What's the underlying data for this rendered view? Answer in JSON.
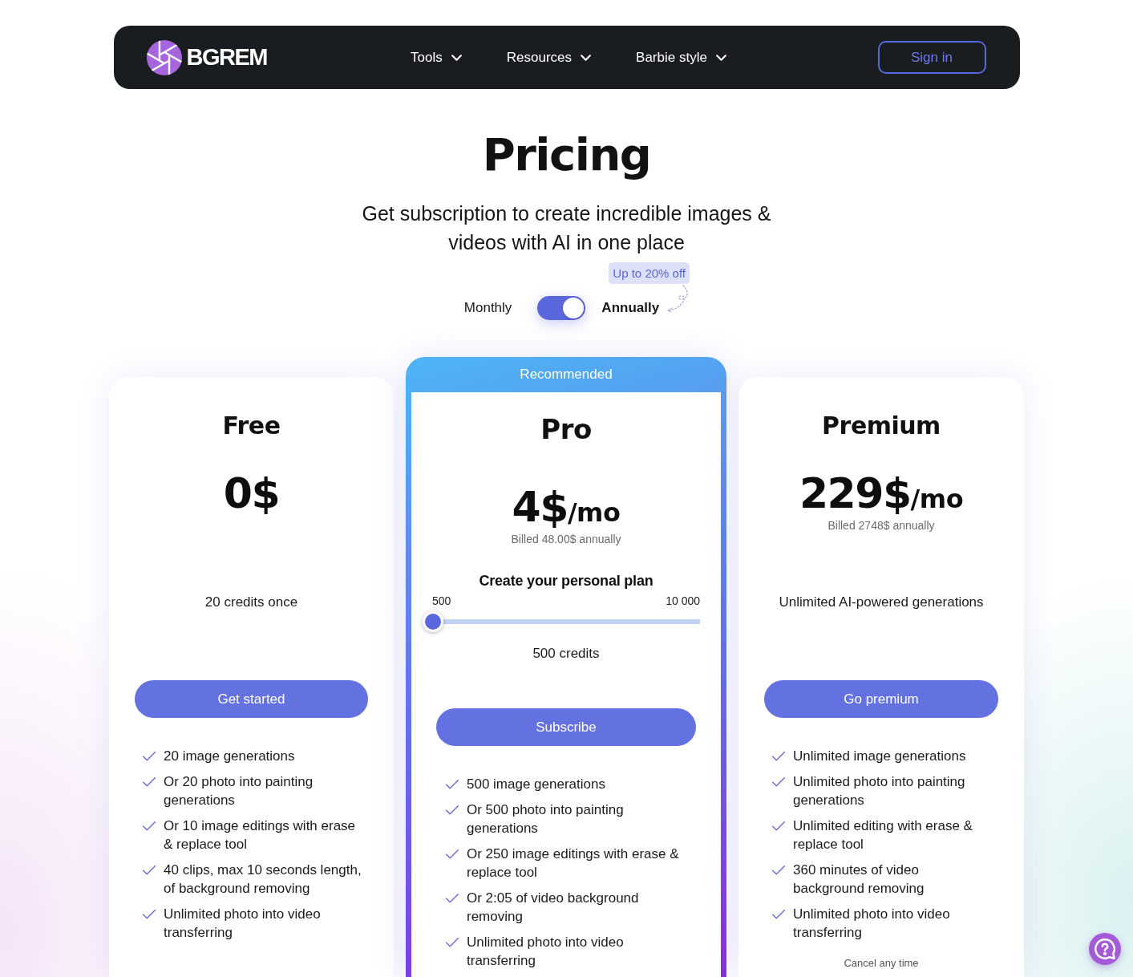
{
  "nav": {
    "logo": "BGREM",
    "items": [
      {
        "label": "Tools"
      },
      {
        "label": "Resources"
      },
      {
        "label": "Barbie style"
      }
    ],
    "sign_in": "Sign in"
  },
  "hero": {
    "title": "Pricing",
    "subtitle": "Get subscription to create incredible images & videos with AI in one place"
  },
  "billing": {
    "monthly_label": "Monthly",
    "annual_label": "Annually",
    "on": true,
    "badge": "Up to 20% off"
  },
  "plans": [
    {
      "name": "Free",
      "recommended": false,
      "price": "0$",
      "credits": "20 credits once",
      "button": "Get started",
      "features": [
        "20 image generations",
        "Or 20 photo into painting generations",
        "Or 10 image editings with erase & replace tool",
        "40 clips, max 10 seconds length, of background removing",
        "Unlimited photo into video transferring"
      ]
    },
    {
      "name": "Pro",
      "recommended": true,
      "ribbon": "Recommended",
      "price": "4$",
      "period": "/mo",
      "billing_note": "Billed 48.00$ annually",
      "custom_plan": {
        "title": "Create your personal plan",
        "min_label": "500",
        "max_label": "10 000",
        "level": 0
      },
      "credits": "500 credits",
      "button": "Subscribe",
      "features": [
        "500 image generations",
        "Or 500 photo into painting generations",
        "Or 250 image editings with erase & replace tool",
        "Or 2:05 of video background removing",
        "Unlimited photo into video transferring"
      ]
    },
    {
      "name": "Premium",
      "recommended": false,
      "price": "229$",
      "period": "/mo",
      "billing_note": "Billed 2748$ annually",
      "credits": "Unlimited AI-powered generations",
      "button": "Go premium",
      "features": [
        "Unlimited image generations",
        "Unlimited photo into painting generations",
        "Unlimited editing with erase & replace tool",
        "360 minutes of video background removing",
        "Unlimited photo into video transferring"
      ],
      "footnote": "Cancel any time"
    }
  ]
}
